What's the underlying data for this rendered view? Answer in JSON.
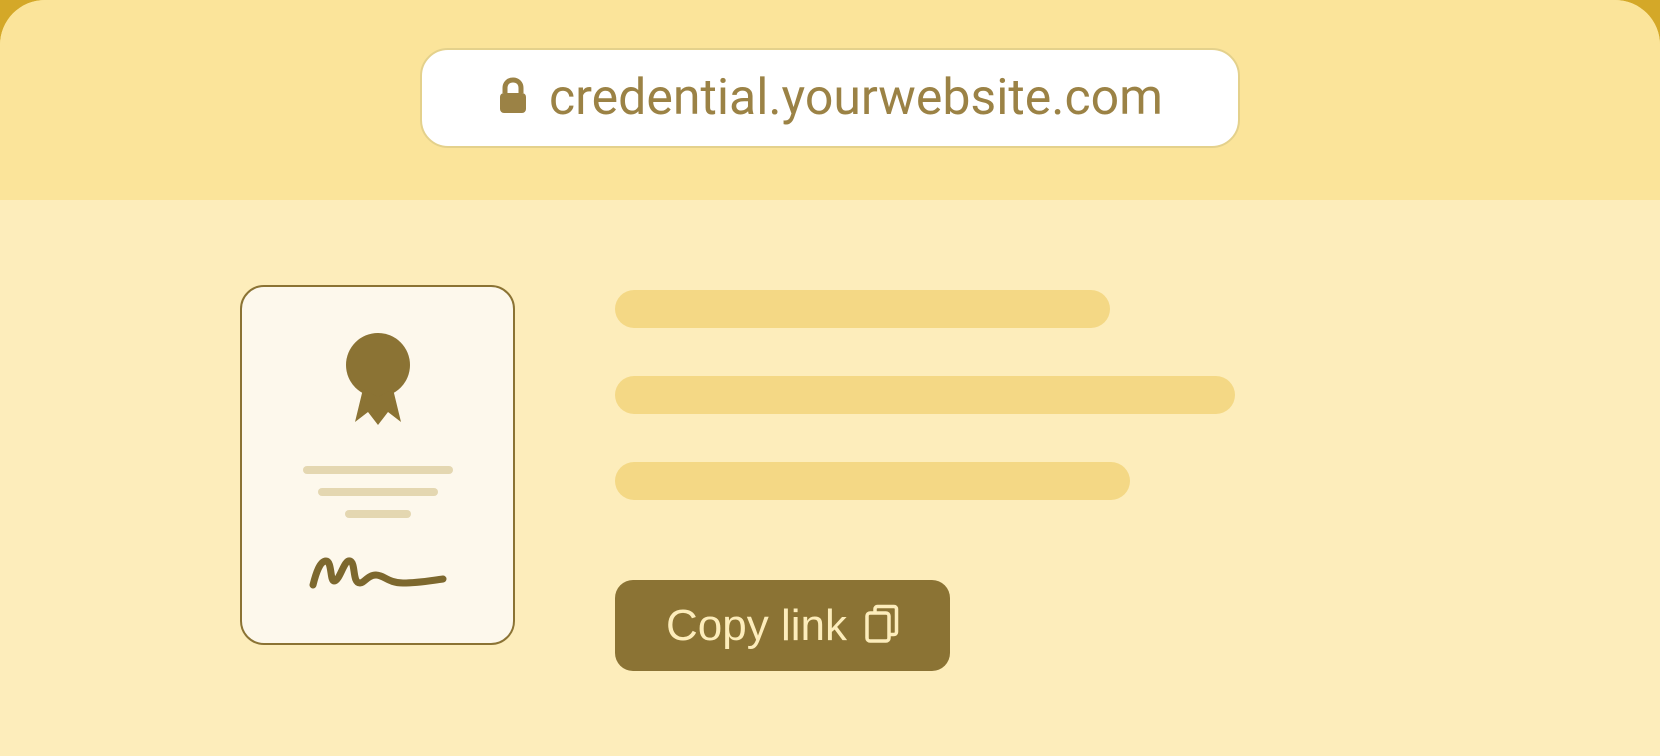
{
  "address_bar": {
    "url": "credential.yourwebsite.com"
  },
  "certificate": {
    "seal_color": "#8b7334",
    "signature_color": "#7d682e"
  },
  "copy_button": {
    "label": "Copy link"
  },
  "colors": {
    "outer_bg": "#d4a828",
    "header_bg": "#fbe49a",
    "content_bg": "#fdedbb",
    "accent": "#8b7334",
    "placeholder": "#f4d885",
    "text_muted": "#9b8245"
  }
}
